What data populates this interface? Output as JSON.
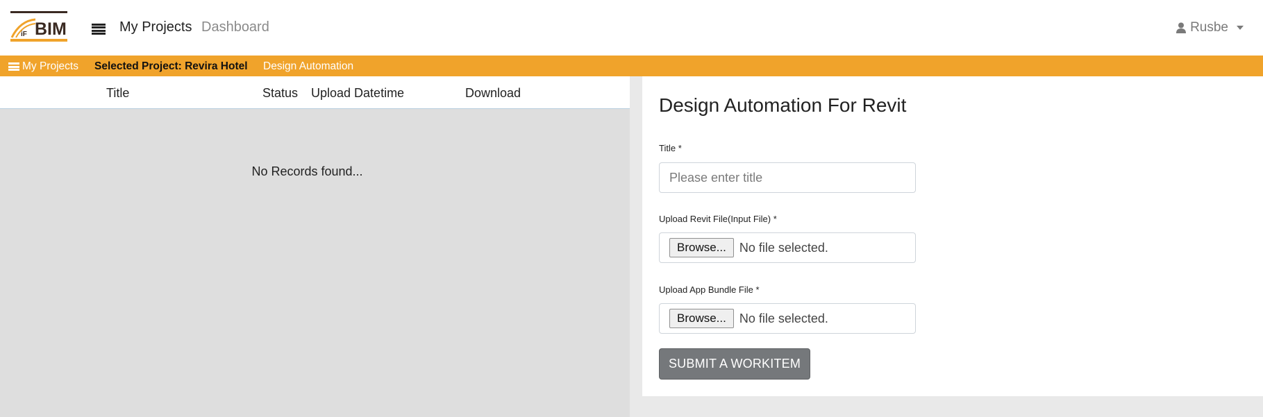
{
  "brand": {
    "logo_text": "BIM",
    "logo_prefix": "iF"
  },
  "nav": {
    "my_projects": "My Projects",
    "dashboard": "Dashboard"
  },
  "user": {
    "name": "Rusbe",
    "icon": "user-icon"
  },
  "breadcrumb": {
    "my_projects": "My Projects",
    "selected_project": "Selected Project: Revira Hotel",
    "current": "Design Automation"
  },
  "table": {
    "columns": [
      "Title",
      "Status",
      "Upload Datetime",
      "Download"
    ],
    "empty_message": "No Records found..."
  },
  "form": {
    "heading": "Design Automation For Revit",
    "title_label": "Title *",
    "title_placeholder": "Please enter title",
    "title_value": "",
    "revit_label": "Upload Revit File(Input File) *",
    "bundle_label": "Upload App Bundle File *",
    "browse_label": "Browse...",
    "revit_status": "No file selected.",
    "bundle_status": "No file selected.",
    "submit_label": "SUBMIT A WORKITEM"
  },
  "colors": {
    "accent": "#f0a32b",
    "logo_dark": "#3a2a22",
    "submit_bg": "#75787b",
    "panel_grey": "#dedede"
  }
}
